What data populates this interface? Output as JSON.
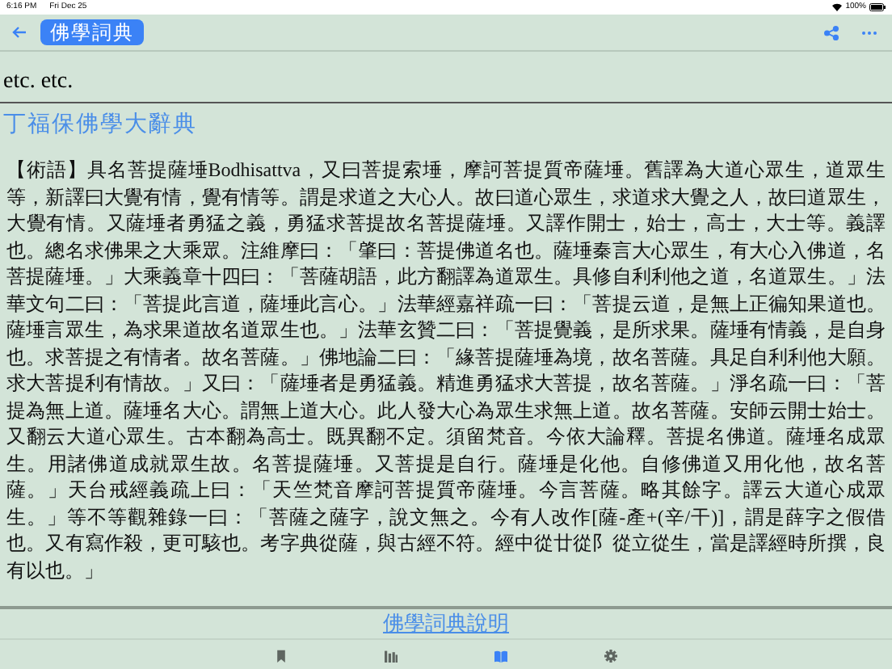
{
  "status_bar": {
    "time": "6:16 PM",
    "date": "Fri Dec 25",
    "battery": "100%"
  },
  "header": {
    "title": "佛學詞典"
  },
  "previous_entry": {
    "text": "etc. etc."
  },
  "source_link": "丁福保佛學大辭典",
  "entry": "【術語】具名菩提薩埵Bodhisattva，又曰菩提索埵，摩訶菩提質帝薩埵。舊譯為大道心眾生，道眾生等，新譯曰大覺有情，覺有情等。謂是求道之大心人。故曰道心眾生，求道求大覺之人，故曰道眾生，大覺有情。又薩埵者勇猛之義，勇猛求菩提故名菩提薩埵。又譯作開士，始士，高士，大士等。義譯也。總名求佛果之大乘眾。注維摩曰：「肇曰：菩提佛道名也。薩埵秦言大心眾生，有大心入佛道，名菩提薩埵。」大乘義章十四曰：「菩薩胡語，此方翻譯為道眾生。具修自利利他之道，名道眾生。」法華文句二曰：「菩提此言道，薩埵此言心。」法華經嘉祥疏一曰：「菩提云道，是無上正徧知果道也。薩埵言眾生，為求果道故名道眾生也。」法華玄贊二曰：「菩提覺義，是所求果。薩埵有情義，是自身也。求菩提之有情者。故名菩薩。」佛地論二曰：「緣菩提薩埵為境，故名菩薩。具足自利利他大願。求大菩提利有情故。」又曰：「薩埵者是勇猛義。精進勇猛求大菩提，故名菩薩。」淨名疏一曰：「菩提為無上道。薩埵名大心。謂無上道大心。此人發大心為眾生求無上道。故名菩薩。安師云開士始士。又翻云大道心眾生。古本翻為高士。既異翻不定。須留梵音。今依大論釋。菩提名佛道。薩埵名成眾生。用諸佛道成就眾生故。名菩提薩埵。又菩提是自行。薩埵是化他。自修佛道又用化他，故名菩薩。」天台戒經義疏上曰：「天竺梵音摩訶菩提質帝薩埵。今言菩薩。略其餘字。譯云大道心成眾生。」等不等觀雜錄一曰：「菩薩之薩字，說文無之。今有人改作[薩-產+(辛/干)]，謂是薛字之假借也。又有寫作殺，更可駭也。考字典從薩，與古經不符。經中從廿從阝從立從生，當是譯經時所撰，良有以也。」",
  "footer_link": "佛學詞典說明",
  "tab_bar": [
    {
      "kind": "bookmark",
      "selected": false
    },
    {
      "kind": "library",
      "selected": false
    },
    {
      "kind": "book",
      "selected": true
    },
    {
      "kind": "settings",
      "selected": false
    }
  ]
}
